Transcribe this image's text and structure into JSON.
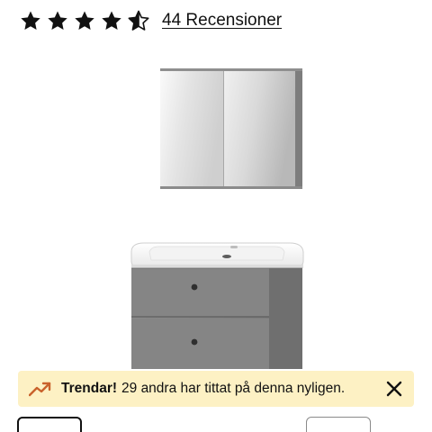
{
  "rating": {
    "value": 4.5,
    "max": 5,
    "review_link": "44 Recensioner"
  },
  "notice": {
    "icon": "trend-up-icon",
    "bold": "Trendar!",
    "text": "29 andra har tittat på denna nyligen.",
    "accent_color": "#c9622c",
    "background_color": "#fdf1c4"
  },
  "colors": {
    "cabinet": "#7b7b7b",
    "sink": "#f4f4f4"
  }
}
